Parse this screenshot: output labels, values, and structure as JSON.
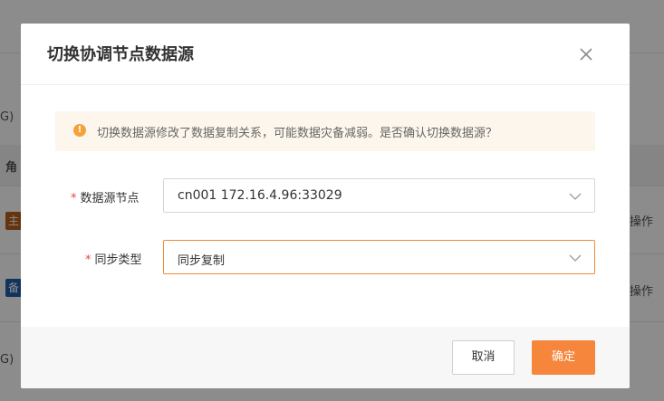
{
  "background": {
    "texts": [
      "G)",
      "角",
      "操作",
      "操作",
      "G)"
    ],
    "tags": [
      {
        "label": "主",
        "color": "#b85f1d"
      },
      {
        "label": "备",
        "color": "#1f5fa8"
      }
    ]
  },
  "dialog": {
    "title": "切换协调节点数据源",
    "alert": {
      "icon": "!",
      "text": "切换数据源修改了数据复制关系，可能数据灾备减弱。是否确认切换数据源？"
    },
    "fields": [
      {
        "required_mark": "*",
        "label": "数据源节点",
        "value": "cn001 172.16.4.96:33029"
      },
      {
        "required_mark": "*",
        "label": "同步类型",
        "value": "同步复制"
      }
    ],
    "buttons": {
      "cancel": "取消",
      "ok": "确定"
    }
  },
  "colors": {
    "accent": "#f5863b",
    "alert_bg": "#fdf6ec",
    "alert_icon": "#f5a23c",
    "required": "#e5484d"
  }
}
